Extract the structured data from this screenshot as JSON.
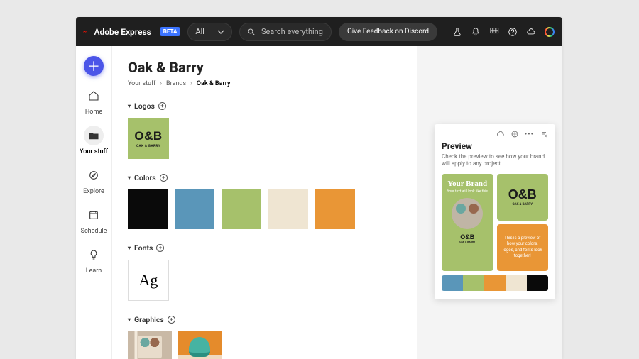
{
  "header": {
    "app_name": "Adobe Express",
    "beta_label": "BETA",
    "filter_label": "All",
    "search_placeholder": "Search everything",
    "feedback_label": "Give Feedback on Discord"
  },
  "sidebar": {
    "items": [
      {
        "label": "Home"
      },
      {
        "label": "Your stuff"
      },
      {
        "label": "Explore"
      },
      {
        "label": "Schedule"
      },
      {
        "label": "Learn"
      }
    ]
  },
  "page": {
    "title": "Oak & Barry",
    "crumbs": [
      "Your stuff",
      "Brands",
      "Oak & Barry"
    ]
  },
  "sections": {
    "logos_label": "Logos",
    "colors_label": "Colors",
    "fonts_label": "Fonts",
    "graphics_label": "Graphics"
  },
  "logo": {
    "big": "O&B",
    "small": "OAK & BARRY"
  },
  "colors": [
    {
      "hex": "#0a0a0a"
    },
    {
      "hex": "#5a96b9"
    },
    {
      "hex": "#a6c16b"
    },
    {
      "hex": "#efe5d2"
    },
    {
      "hex": "#e99636"
    }
  ],
  "font_sample": "Ag",
  "preview": {
    "title": "Preview",
    "subtitle": "Check the preview to see how your brand will apply to any project.",
    "card_a_head": "Your Brand",
    "card_a_sub": "Your text will look like this",
    "card_c_text": "This is a preview of how your colors, logos, and fonts look together!",
    "palette": [
      "#5a96b9",
      "#a6c16b",
      "#e99636",
      "#efe5d2",
      "#0a0a0a"
    ]
  }
}
